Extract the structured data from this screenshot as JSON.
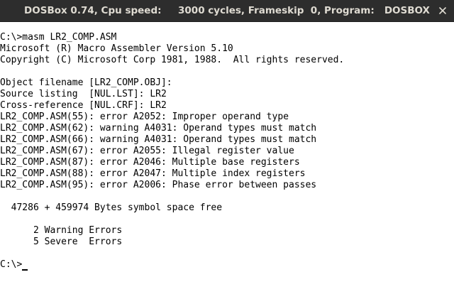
{
  "window": {
    "title": "DOSBox 0.74, Cpu speed:     3000 cycles, Frameskip  0, Program:   DOSBOX",
    "close_icon": "close-icon"
  },
  "terminal": {
    "lines": [
      "C:\\>masm LR2_COMP.ASM",
      "Microsoft (R) Macro Assembler Version 5.10",
      "Copyright (C) Microsoft Corp 1981, 1988.  All rights reserved.",
      "",
      "Object filename [LR2_COMP.OBJ]:",
      "Source listing  [NUL.LST]: LR2",
      "Cross-reference [NUL.CRF]: LR2",
      "LR2_COMP.ASM(55): error A2052: Improper operand type",
      "LR2_COMP.ASM(62): warning A4031: Operand types must match",
      "LR2_COMP.ASM(66): warning A4031: Operand types must match",
      "LR2_COMP.ASM(67): error A2055: Illegal register value",
      "LR2_COMP.ASM(87): error A2046: Multiple base registers",
      "LR2_COMP.ASM(88): error A2047: Multiple index registers",
      "LR2_COMP.ASM(95): error A2006: Phase error between passes",
      "",
      "  47286 + 459974 Bytes symbol space free",
      "",
      "      2 Warning Errors",
      "      5 Severe  Errors",
      ""
    ],
    "prompt": "C:\\>"
  }
}
